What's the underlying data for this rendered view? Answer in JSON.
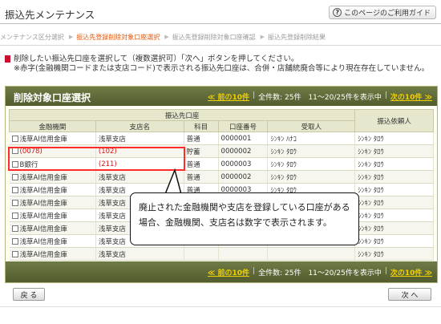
{
  "header": {
    "title": "振込先メンテナンス",
    "guide_label": "このページのご利用ガイド",
    "guide_icon": "?"
  },
  "steps": [
    {
      "label": "メンテナンス区分選択",
      "active": false
    },
    {
      "label": "振込先登録削除対象口座選択",
      "active": true
    },
    {
      "label": "振込先登録削除対象口座確認",
      "active": false
    },
    {
      "label": "振込先登録削除結果",
      "active": false
    }
  ],
  "instructions": {
    "line1": "削除したい振込先口座を選択して（複数選択可）「次へ」ボタンを押してください。",
    "line2": "※赤字(金融機関コードまたは支店コード)で表示される振込先口座は、合併・店舗統廃合等により現在存在していません。"
  },
  "panel": {
    "title": "削除対象口座選択",
    "pager": {
      "prev": "≪ 前の10件",
      "total": "全件数: 25件　11〜20/25件を表示中",
      "next": "次の10件 ≫",
      "sep": "|"
    }
  },
  "table": {
    "group_header": "振込先口座",
    "columns": [
      "金融機関",
      "支店名",
      "科目",
      "口座番号",
      "受取人",
      "振込依頼人"
    ],
    "rows": [
      [
        "浅草AI信用金庫",
        "浅草支店",
        "普通",
        "0000001",
        "ｼﾝｷﾝ ﾊﾅｺ",
        "ｼﾝｷﾝ ﾀﾛｳ"
      ],
      [
        "(0078)",
        "(102)",
        "貯蓄",
        "0000002",
        "ｼﾝｷﾝ ﾀﾛｳ",
        "ｼﾝｷﾝ ﾀﾛｳ"
      ],
      [
        "B銀行",
        "(211)",
        "普通",
        "0000003",
        "ｼﾝｷﾝ ﾀﾛｳ",
        "ｼﾝｷﾝ ﾀﾛｳ"
      ],
      [
        "浅草AI信用金庫",
        "浅草支店",
        "普通",
        "0000002",
        "ｼﾝｷﾝ ﾀﾛｳ",
        "ｼﾝｷﾝ ﾀﾛｳ"
      ],
      [
        "浅草AI信用金庫",
        "浅草支店",
        "普通",
        "0000003",
        "ｼﾝｷﾝ ﾀﾛｳ",
        "ｼﾝｷﾝ ﾀﾛｳ"
      ],
      [
        "浅草AI信用金庫",
        "浅草支店",
        "",
        "",
        "",
        "ｼﾝｷﾝ ﾀﾛｳ"
      ],
      [
        "浅草AI信用金庫",
        "浅草支店",
        "",
        "",
        "",
        "ｼﾝｷﾝ ﾀﾛｳ"
      ],
      [
        "浅草AI信用金庫",
        "浅草支店",
        "",
        "",
        "",
        "ｼﾝｷﾝ ﾀﾛｳ"
      ],
      [
        "浅草AI信用金庫",
        "浅草支店",
        "",
        "",
        "",
        "ｼﾝｷﾝ ﾀﾛｳ"
      ],
      [
        "浅草AI信用金庫",
        "浅草支店",
        "",
        "",
        "",
        "ｼﾝｷﾝ ﾀﾛｳ"
      ]
    ],
    "red_cells": [
      [
        1,
        0
      ],
      [
        1,
        1
      ],
      [
        2,
        1
      ]
    ],
    "red_color": "#d21414"
  },
  "callout": {
    "text": "廃止された金融機関や支店を登録している口座がある場合、金融機関、支店名は数字で表示されます。"
  },
  "buttons": {
    "back": "戻 る",
    "next": "次 へ"
  },
  "colors": {
    "panel_header": "#5f6a38",
    "pager_link": "#f0d000",
    "active_step": "#e4580a",
    "highlight": "#ff2a2a"
  }
}
